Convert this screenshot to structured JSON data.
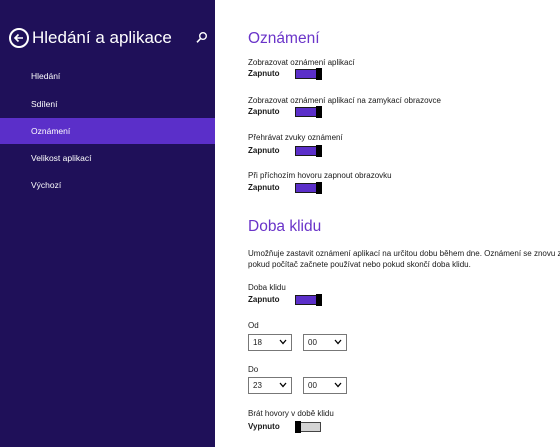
{
  "sidebar": {
    "title": "Hledání a aplikace",
    "items": [
      {
        "label": "Hledání"
      },
      {
        "label": "Sdílení"
      },
      {
        "label": "Oznámení"
      },
      {
        "label": "Velikost aplikací"
      },
      {
        "label": "Výchozí"
      }
    ],
    "selected_index": 2
  },
  "notifications": {
    "title": "Oznámení",
    "settings": [
      {
        "label": "Zobrazovat oznámení aplikací",
        "state": "Zapnuto"
      },
      {
        "label": "Zobrazovat oznámení aplikací na zamykací obrazovce",
        "state": "Zapnuto"
      },
      {
        "label": "Přehrávat zvuky oznámení",
        "state": "Zapnuto"
      },
      {
        "label": "Při příchozím hovoru zapnout obrazovku",
        "state": "Zapnuto"
      }
    ]
  },
  "quiet_hours": {
    "title": "Doba klidu",
    "description_line1": "Umožňuje zastavit oznámení aplikací na určitou dobu během dne. Oznámení se znovu zapr",
    "description_line2": "pokud počítač začnete používat nebo pokud skončí doba klidu.",
    "toggle": {
      "label": "Doba klidu",
      "state": "Zapnuto"
    },
    "from": {
      "label": "Od",
      "hour": "18",
      "minute": "00"
    },
    "to": {
      "label": "Do",
      "hour": "23",
      "minute": "00"
    },
    "calls": {
      "label": "Brát hovory v době klidu",
      "state": "Vypnuto"
    }
  },
  "colors": {
    "sidebar_bg": "#1f1059",
    "accent": "#5b2fc9",
    "title": "#6a34c9"
  },
  "icons": {
    "back": "back-arrow-icon",
    "search": "search-icon",
    "dropdown": "chevron-down-icon"
  }
}
